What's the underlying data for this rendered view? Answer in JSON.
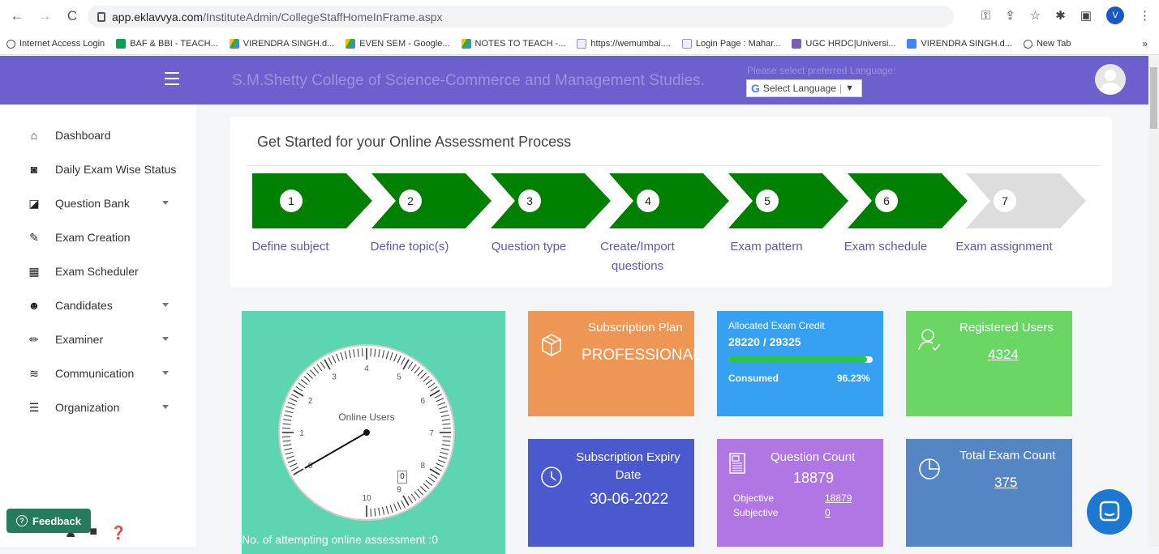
{
  "browser": {
    "url_host": "app.eklavvya.com",
    "url_path": "/InstituteAdmin/CollegeStaffHomeInFrame.aspx",
    "profile_initial": "V",
    "bookmarks": [
      "Internet Access Login",
      "BAF & BBI - TEACH...",
      "VIRENDRA SINGH.d...",
      "EVEN SEM - Google...",
      "NOTES TO TEACH -...",
      "https://wemumbai....",
      "Login Page : Mahar...",
      "UGC HRDC|Universi...",
      "VIRENDRA SINGH.d...",
      "New Tab"
    ],
    "more": "»"
  },
  "header": {
    "college_name": "S.M.Shetty College of Science-Commerce and Management Studies.",
    "language_hint": "Please select preferred Language:",
    "language_select": "Select Language",
    "language_arrow": "▼"
  },
  "sidebar": {
    "items": [
      {
        "label": "Dashboard"
      },
      {
        "label": "Daily Exam Wise Status"
      },
      {
        "label": "Question Bank"
      },
      {
        "label": "Exam Creation"
      },
      {
        "label": "Exam Scheduler"
      },
      {
        "label": "Candidates"
      },
      {
        "label": "Examiner"
      },
      {
        "label": "Communication"
      },
      {
        "label": "Organization"
      }
    ],
    "feedback": "Feedback"
  },
  "process": {
    "title": "Get Started for your Online Assessment Process",
    "steps": [
      {
        "num": "1",
        "label": "Define subject"
      },
      {
        "num": "2",
        "label": "Define topic(s)"
      },
      {
        "num": "3",
        "label": "Question type"
      },
      {
        "num": "4",
        "label": "Create/Import questions"
      },
      {
        "num": "5",
        "label": "Exam pattern"
      },
      {
        "num": "6",
        "label": "Exam schedule"
      },
      {
        "num": "7",
        "label": "Exam assignment"
      }
    ]
  },
  "dashboard": {
    "online_users_label": "Online Users",
    "online_users_value": "0",
    "clock_numbers": [
      "0",
      "1",
      "2",
      "3",
      "4",
      "5",
      "6",
      "7",
      "8",
      "9",
      "10"
    ],
    "attempting": "No. of attempting online assessment :0",
    "subscription_plan_title": "Subscription Plan",
    "subscription_plan_value": "PROFESSIONAL",
    "expiry_title": "Subscription Expiry Date",
    "expiry_value": "30-06-2022",
    "credit_title": "Allocated Exam Credit",
    "credit_value": "28220 / 29325",
    "credit_fraction": 0.9623,
    "consumed_label": "Consumed",
    "consumed_percent": "96.23%",
    "question_count_title": "Question Count",
    "question_count_value": "18879",
    "objective_label": "Objective",
    "objective_value": "18879",
    "subjective_label": "Subjective",
    "subjective_value": "0",
    "registered_title": "Registered Users",
    "registered_value": "4324",
    "total_exam_title": "Total Exam Count",
    "total_exam_value": "375"
  },
  "colors": {
    "header": "#6b60cc",
    "step_active": "#008000",
    "step_inactive": "#dddddd"
  }
}
